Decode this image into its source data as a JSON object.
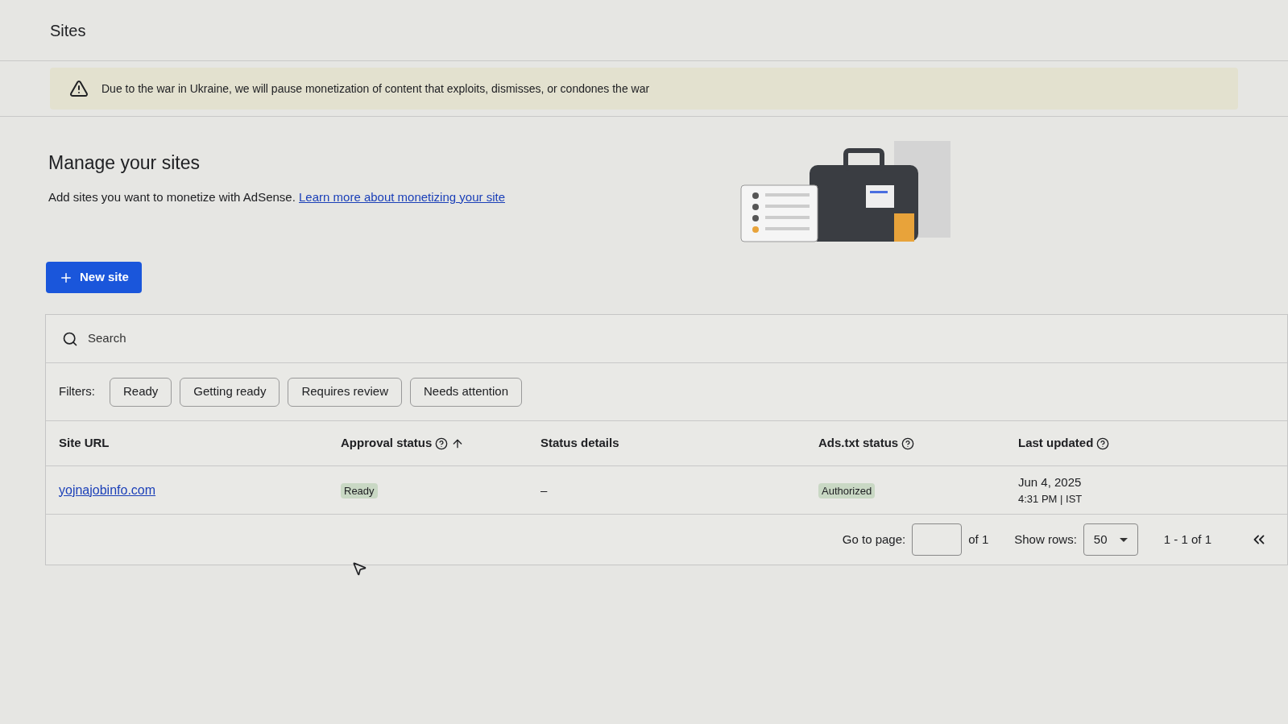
{
  "header": {
    "title": "Sites"
  },
  "banner": {
    "text": "Due to the war in Ukraine, we will pause monetization of content that exploits, dismisses, or condones the war"
  },
  "intro": {
    "heading": "Manage your sites",
    "text": "Add sites you want to monetize with AdSense.",
    "link": "Learn more about monetizing your site"
  },
  "new_site_button": {
    "label": "New site"
  },
  "search": {
    "placeholder": "Search"
  },
  "filters": {
    "label": "Filters:",
    "chips": [
      {
        "label": "Ready",
        "selected": false
      },
      {
        "label": "Getting ready",
        "selected": false
      },
      {
        "label": "Requires review",
        "selected": false
      },
      {
        "label": "Needs attention",
        "selected": false
      }
    ]
  },
  "table": {
    "columns": [
      {
        "label": "Site URL",
        "help": false,
        "sorted": false
      },
      {
        "label": "Approval status",
        "help": true,
        "sorted": true
      },
      {
        "label": "Status details",
        "help": false,
        "sorted": false
      },
      {
        "label": "Ads.txt status",
        "help": true,
        "sorted": false
      },
      {
        "label": "Last updated",
        "help": true,
        "sorted": false
      }
    ],
    "rows": [
      {
        "site_url": "yojnajobinfo.com",
        "approval_status": "Ready",
        "status_details": "–",
        "ads_txt_status": "Authorized",
        "last_updated_date": "Jun 4, 2025",
        "last_updated_time": "4:31 PM | IST"
      }
    ]
  },
  "pagination": {
    "go_to_label": "Go to page:",
    "of_pages": "of 1",
    "show_rows_label": "Show rows:",
    "rows_value": "50",
    "range": "1 - 1 of 1"
  }
}
